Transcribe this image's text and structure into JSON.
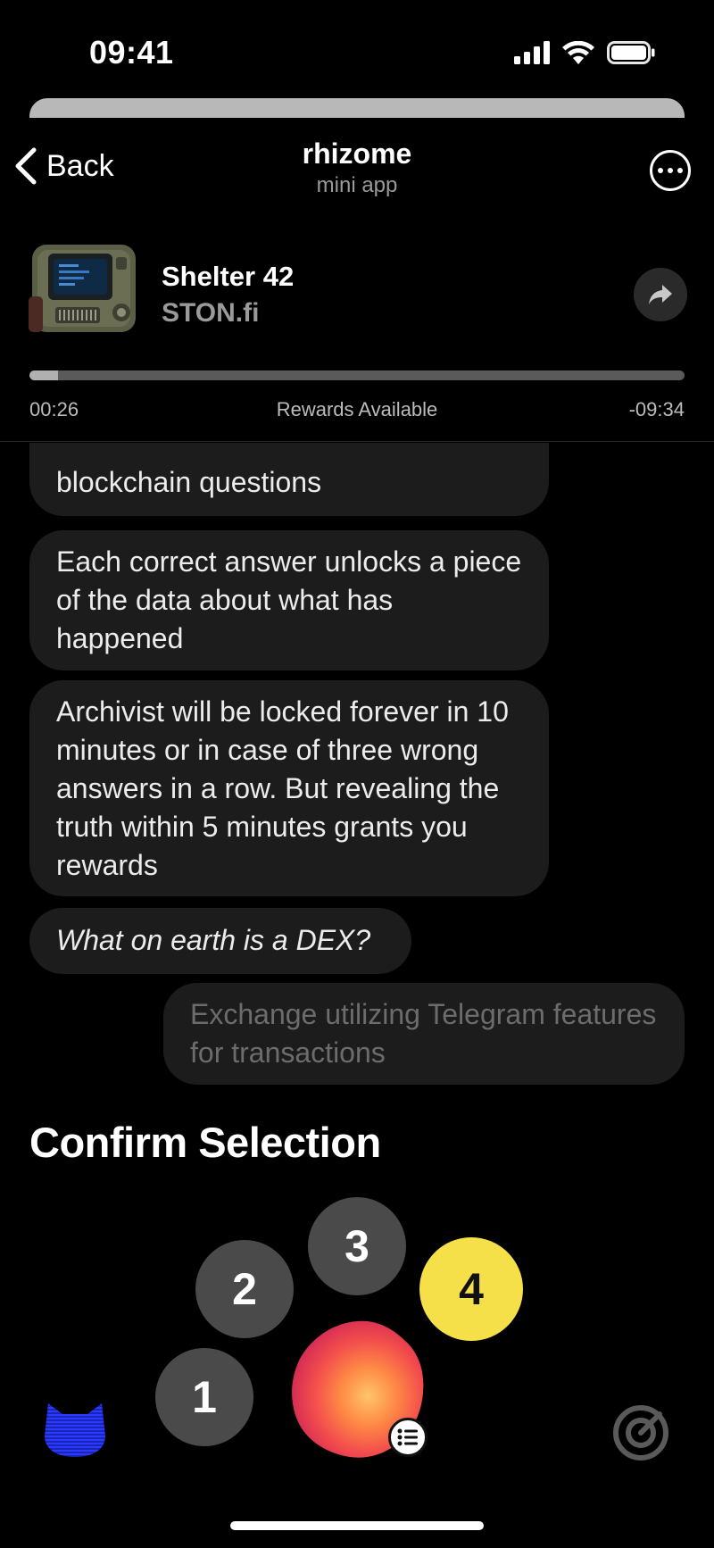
{
  "status_bar": {
    "time": "09:41"
  },
  "nav": {
    "back_label": "Back",
    "title": "rhizome",
    "subtitle": "mini app"
  },
  "player": {
    "title": "Shelter 42",
    "artist": "STON.fi",
    "elapsed": "00:26",
    "status": "Rewards Available",
    "remaining": "-09:34",
    "progress_fraction": 0.043
  },
  "chat": {
    "messages": [
      {
        "text": "blockchain questions"
      },
      {
        "text": "Each correct answer unlocks a piece of the data about what has happened"
      },
      {
        "text": "Archivist will be locked forever in 10 minutes or in case of three wrong answers in a row. But revealing the truth within 5 minutes grants you rewards"
      },
      {
        "text": "What on earth is a DEX?"
      }
    ],
    "selected_answer": "Exchange utilizing Telegram features for transactions"
  },
  "confirm": {
    "title": "Confirm Selection",
    "options": [
      "1",
      "2",
      "3",
      "4"
    ],
    "selected_option": "4"
  },
  "colors": {
    "background": "#000000",
    "bubble": "#1c1c1c",
    "option": "#4a4a4a",
    "option_selected": "#f5e04a",
    "progress_fill": "#b0b0b0"
  },
  "icons": {
    "back": "chevron-left-icon",
    "more": "more-icon",
    "share": "share-icon",
    "orb_badge": "list-icon",
    "left_dock": "cat-icon",
    "right_dock": "gauge-icon"
  }
}
